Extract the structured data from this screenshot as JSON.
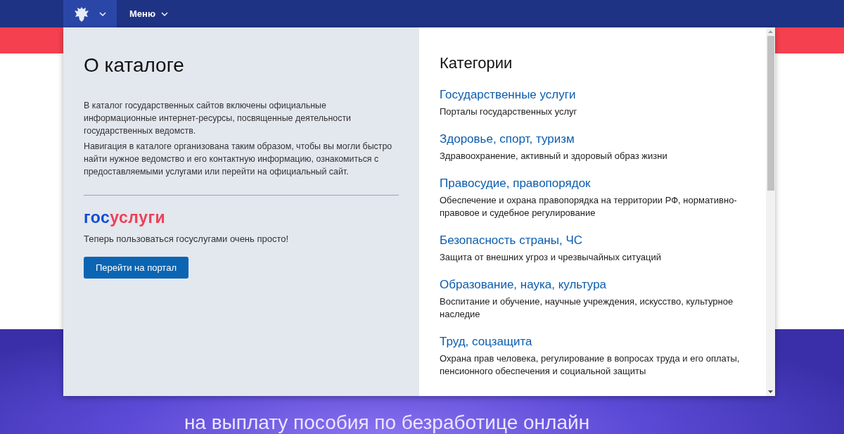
{
  "nav": {
    "menu_label": "Меню"
  },
  "catalog": {
    "title": "О каталоге",
    "paragraphs": [
      "В каталог государственных сайтов включены официальные информационные интернет-ресурсы, посвященные деятельности государственных ведомств.",
      "Навигация в каталоге организована таким образом, чтобы вы могли быстро найти нужное ведомство и его контактную информацию, ознакомиться с предоставляемыми услугами или перейти на официальный сайт."
    ],
    "logo": {
      "first": "гос",
      "second": "услуги"
    },
    "promo": "Теперь пользоваться госуслугами очень просто!",
    "button": "Перейти на портал"
  },
  "categories": {
    "title": "Категории",
    "items": [
      {
        "name": "Государственные услуги",
        "description": "Порталы государственных услуг"
      },
      {
        "name": "Здоровье, спорт, туризм",
        "description": "Здравоохранение, активный и здоровый образ жизни"
      },
      {
        "name": "Правосудие, правопорядок",
        "description": "Обеспечение и охрана правопорядка на территории РФ, нормативно-правовое и судебное регулирование"
      },
      {
        "name": "Безопасность страны, ЧС",
        "description": "Защита от внешних угроз и чрезвычайных ситуаций"
      },
      {
        "name": "Образование, наука, культура",
        "description": "Воспитание и обучение, научные учреждения, искусство, культурное наследие"
      },
      {
        "name": "Труд, соцзащита",
        "description": "Охрана прав человека, регулирование в вопросах труда и его оплаты, пенсионного обеспечения и социальной защиты"
      }
    ]
  },
  "banner": {
    "subtitle": "на выплату пособия по безработице онлайн"
  }
}
